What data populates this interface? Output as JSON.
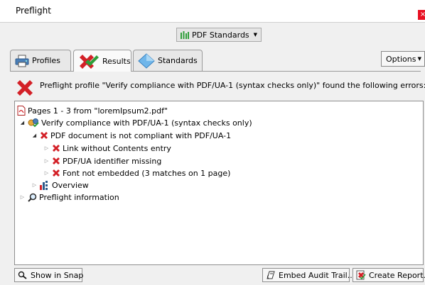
{
  "window": {
    "title": "Preflight",
    "close_glyph": "×"
  },
  "toolbar": {
    "standards_dropdown_label": "PDF Standards"
  },
  "tabs": [
    {
      "label": "Profiles",
      "icon": "printer-icon"
    },
    {
      "label": "Results",
      "icon": "results-check-icon",
      "active": true
    },
    {
      "label": "Standards",
      "icon": "diamond-icon"
    }
  ],
  "options": {
    "label": "Options"
  },
  "summary": {
    "message": "Preflight profile \"Verify compliance with PDF/UA-1 (syntax checks only)\" found the following errors:"
  },
  "tree": {
    "file": "Pages 1 - 3 from \"loremIpsum2.pdf\"",
    "profile": "Verify compliance with PDF/UA-1 (syntax checks only)",
    "error_group": "PDF document is not compliant with PDF/UA-1",
    "errors": [
      "Link without Contents entry",
      "PDF/UA identifier missing",
      "Font not embedded (3 matches on 1 page)"
    ],
    "overview": "Overview",
    "preflight_info": "Preflight information"
  },
  "buttons": {
    "show_in_snap": "Show in Snap",
    "embed_audit_trail": "Embed Audit Trail...",
    "create_report": "Create Report..."
  },
  "colors": {
    "error_red": "#d32027",
    "close_red": "#e81123",
    "check_green": "#2e9e3a"
  }
}
